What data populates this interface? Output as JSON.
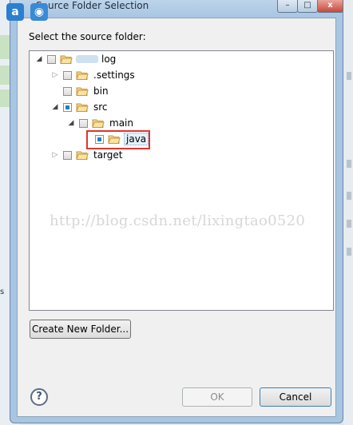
{
  "window": {
    "title": "Source Folder Selection",
    "controls": {
      "minimize": "–",
      "maximize": "□",
      "close": "x"
    }
  },
  "app_icons": {
    "a": "a",
    "eye": "◉"
  },
  "prompt": "Select the source folder:",
  "tree": [
    {
      "label": "log",
      "expanded": true,
      "checked": false,
      "depth": 0
    },
    {
      "label": ".settings",
      "expanded": false,
      "checked": false,
      "depth": 1
    },
    {
      "label": "bin",
      "expanded": null,
      "checked": false,
      "depth": 1
    },
    {
      "label": "src",
      "expanded": true,
      "checked": "partial",
      "depth": 1
    },
    {
      "label": "main",
      "expanded": true,
      "checked": false,
      "depth": 2
    },
    {
      "label": "java",
      "expanded": null,
      "checked": "partial",
      "depth": 3,
      "selected": true
    },
    {
      "label": "target",
      "expanded": false,
      "checked": false,
      "depth": 1
    }
  ],
  "watermark": "http://blog.csdn.net/lixingtao0520",
  "buttons": {
    "create_new_folder": "Create New Folder...",
    "ok": "OK",
    "cancel": "Cancel",
    "help": "?"
  },
  "background": {
    "side_letter": "s"
  },
  "colors": {
    "titlebar": "#a8c5e2",
    "highlight": "#e0352b",
    "checkbox_fill": "#2c7fa8"
  }
}
